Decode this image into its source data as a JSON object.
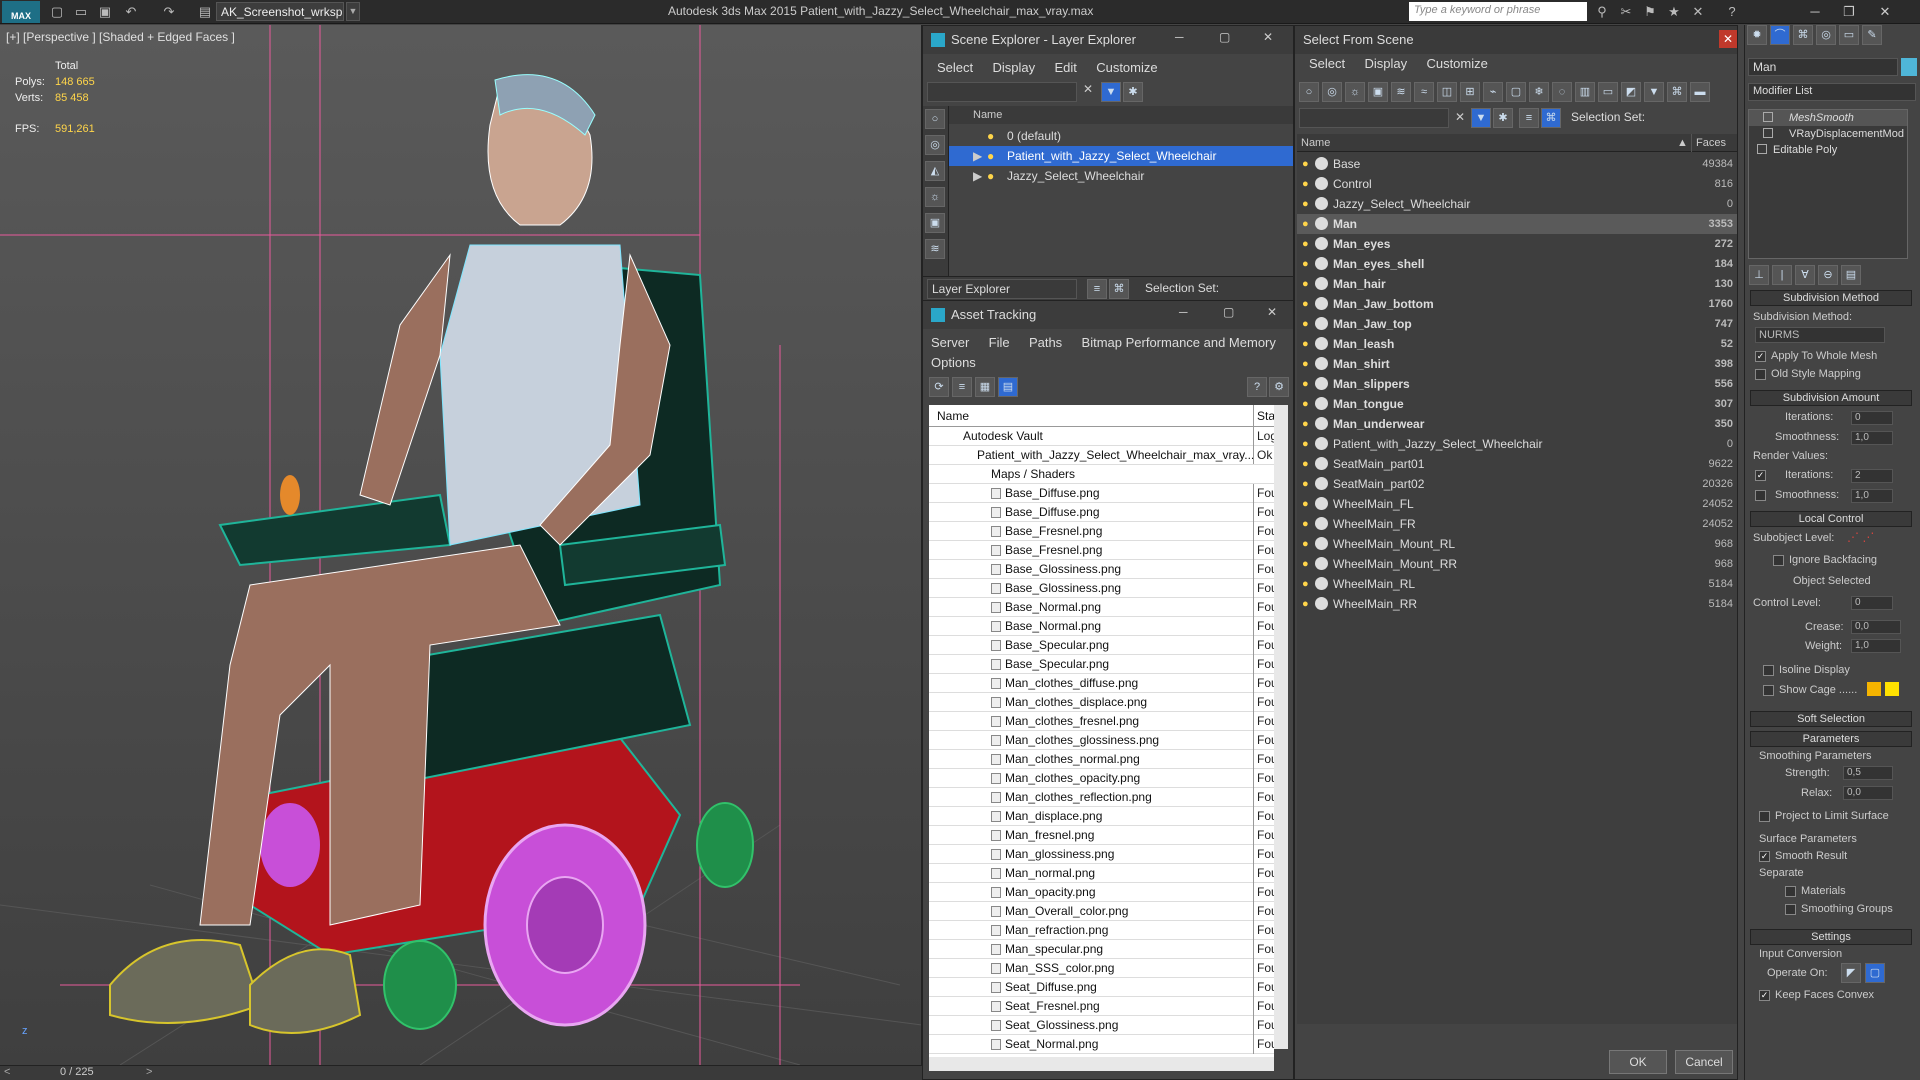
{
  "titlebar": {
    "logo": "MAX",
    "workspace": "AK_Screenshot_wrksp",
    "app_title": "Autodesk 3ds Max  2015    Patient_with_Jazzy_Select_Wheelchair_max_vray.max",
    "keyword_placeholder": "Type a keyword or phrase"
  },
  "viewport": {
    "label": "[+] [Perspective ] [Shaded + Edged Faces ]",
    "stats": {
      "total_label": "Total",
      "polys_label": "Polys:",
      "polys_value": "148 665",
      "verts_label": "Verts:",
      "verts_value": "85 458",
      "fps_label": "FPS:",
      "fps_value": "591,261"
    },
    "axis_z": "z",
    "timeline": "0 / 225"
  },
  "scene_explorer": {
    "title": "Scene Explorer - Layer Explorer",
    "menu": [
      "Select",
      "Display",
      "Edit",
      "Customize"
    ],
    "col_name": "Name",
    "layers": [
      "0 (default)",
      "Patient_with_Jazzy_Select_Wheelchair",
      "Jazzy_Select_Wheelchair"
    ],
    "bottom_label": "Layer Explorer",
    "selection_set": "Selection Set:"
  },
  "asset_tracking": {
    "title": "Asset Tracking",
    "menu": [
      "Server",
      "File",
      "Paths",
      "Bitmap Performance and Memory"
    ],
    "menu2": "Options",
    "col_name": "Name",
    "col_status": "Stat",
    "vault": "Autodesk Vault",
    "vault_status": "Logo",
    "file": "Patient_with_Jazzy_Select_Wheelchair_max_vray...",
    "file_status": "Ok",
    "maps_folder": "Maps / Shaders",
    "files": [
      "Base_Diffuse.png",
      "Base_Diffuse.png",
      "Base_Fresnel.png",
      "Base_Fresnel.png",
      "Base_Glossiness.png",
      "Base_Glossiness.png",
      "Base_Normal.png",
      "Base_Normal.png",
      "Base_Specular.png",
      "Base_Specular.png",
      "Man_clothes_diffuse.png",
      "Man_clothes_displace.png",
      "Man_clothes_fresnel.png",
      "Man_clothes_glossiness.png",
      "Man_clothes_normal.png",
      "Man_clothes_opacity.png",
      "Man_clothes_reflection.png",
      "Man_displace.png",
      "Man_fresnel.png",
      "Man_glossiness.png",
      "Man_normal.png",
      "Man_opacity.png",
      "Man_Overall_color.png",
      "Man_refraction.png",
      "Man_specular.png",
      "Man_SSS_color.png",
      "Seat_Diffuse.png",
      "Seat_Fresnel.png",
      "Seat_Glossiness.png",
      "Seat_Normal.png"
    ],
    "file_status_each": "Four"
  },
  "select_from_scene": {
    "title": "Select From Scene",
    "menu": [
      "Select",
      "Display",
      "Customize"
    ],
    "selection_set": "Selection Set:",
    "col_name": "Name",
    "col_faces": "Faces",
    "objects": [
      {
        "name": "Base",
        "faces": "49384"
      },
      {
        "name": "Control",
        "faces": "816"
      },
      {
        "name": "Jazzy_Select_Wheelchair",
        "faces": "0"
      },
      {
        "name": "Man",
        "faces": "3353"
      },
      {
        "name": "Man_eyes",
        "faces": "272"
      },
      {
        "name": "Man_eyes_shell",
        "faces": "184"
      },
      {
        "name": "Man_hair",
        "faces": "130"
      },
      {
        "name": "Man_Jaw_bottom",
        "faces": "1760"
      },
      {
        "name": "Man_Jaw_top",
        "faces": "747"
      },
      {
        "name": "Man_leash",
        "faces": "52"
      },
      {
        "name": "Man_shirt",
        "faces": "398"
      },
      {
        "name": "Man_slippers",
        "faces": "556"
      },
      {
        "name": "Man_tongue",
        "faces": "307"
      },
      {
        "name": "Man_underwear",
        "faces": "350"
      },
      {
        "name": "Patient_with_Jazzy_Select_Wheelchair",
        "faces": "0"
      },
      {
        "name": "SeatMain_part01",
        "faces": "9622"
      },
      {
        "name": "SeatMain_part02",
        "faces": "20326"
      },
      {
        "name": "WheelMain_FL",
        "faces": "24052"
      },
      {
        "name": "WheelMain_FR",
        "faces": "24052"
      },
      {
        "name": "WheelMain_Mount_RL",
        "faces": "968"
      },
      {
        "name": "WheelMain_Mount_RR",
        "faces": "968"
      },
      {
        "name": "WheelMain_RL",
        "faces": "5184"
      },
      {
        "name": "WheelMain_RR",
        "faces": "5184"
      }
    ],
    "ok": "OK",
    "cancel": "Cancel"
  },
  "command_panel": {
    "object_name": "Man",
    "modifier_list": "Modifier List",
    "stack": [
      "MeshSmooth",
      "VRayDisplacementMod",
      "Editable Poly"
    ],
    "subdivision_method_head": "Subdivision Method",
    "subdivision_method_label": "Subdivision Method:",
    "subdivision_method_value": "NURMS",
    "apply_whole": "Apply To Whole Mesh",
    "old_style": "Old Style Mapping",
    "subdivision_amount_head": "Subdivision Amount",
    "iterations_label": "Iterations:",
    "iterations_value": "0",
    "smoothness_label": "Smoothness:",
    "smoothness_value": "1,0",
    "render_values": "Render Values:",
    "r_iterations_value": "2",
    "r_smoothness_value": "1,0",
    "local_control_head": "Local Control",
    "subobject_level": "Subobject Level:",
    "ignore_backfacing": "Ignore Backfacing",
    "object_selected": "Object Selected",
    "control_level_label": "Control Level:",
    "control_level_value": "0",
    "crease_label": "Crease:",
    "crease_value": "0,0",
    "weight_label": "Weight:",
    "weight_value": "1,0",
    "isoline": "Isoline Display",
    "show_cage": "Show Cage ......",
    "soft_selection_head": "Soft Selection",
    "parameters_head": "Parameters",
    "smoothing_params": "Smoothing Parameters",
    "strength_label": "Strength:",
    "strength_value": "0,5",
    "relax_label": "Relax:",
    "relax_value": "0,0",
    "project_limit": "Project to Limit Surface",
    "surface_params": "Surface Parameters",
    "smooth_result": "Smooth Result",
    "separate": "Separate",
    "materials": "Materials",
    "smoothing_groups": "Smoothing Groups",
    "settings_head": "Settings",
    "input_conversion": "Input Conversion",
    "operate_on": "Operate On:",
    "keep_faces": "Keep Faces Convex"
  },
  "colors": {
    "selection_blue": "#2f6ad1",
    "stat_yellow": "#ffd54a",
    "wire_teal": "#1fb59a",
    "wheel_magenta": "#c84fd8",
    "base_red": "#b3141c"
  }
}
